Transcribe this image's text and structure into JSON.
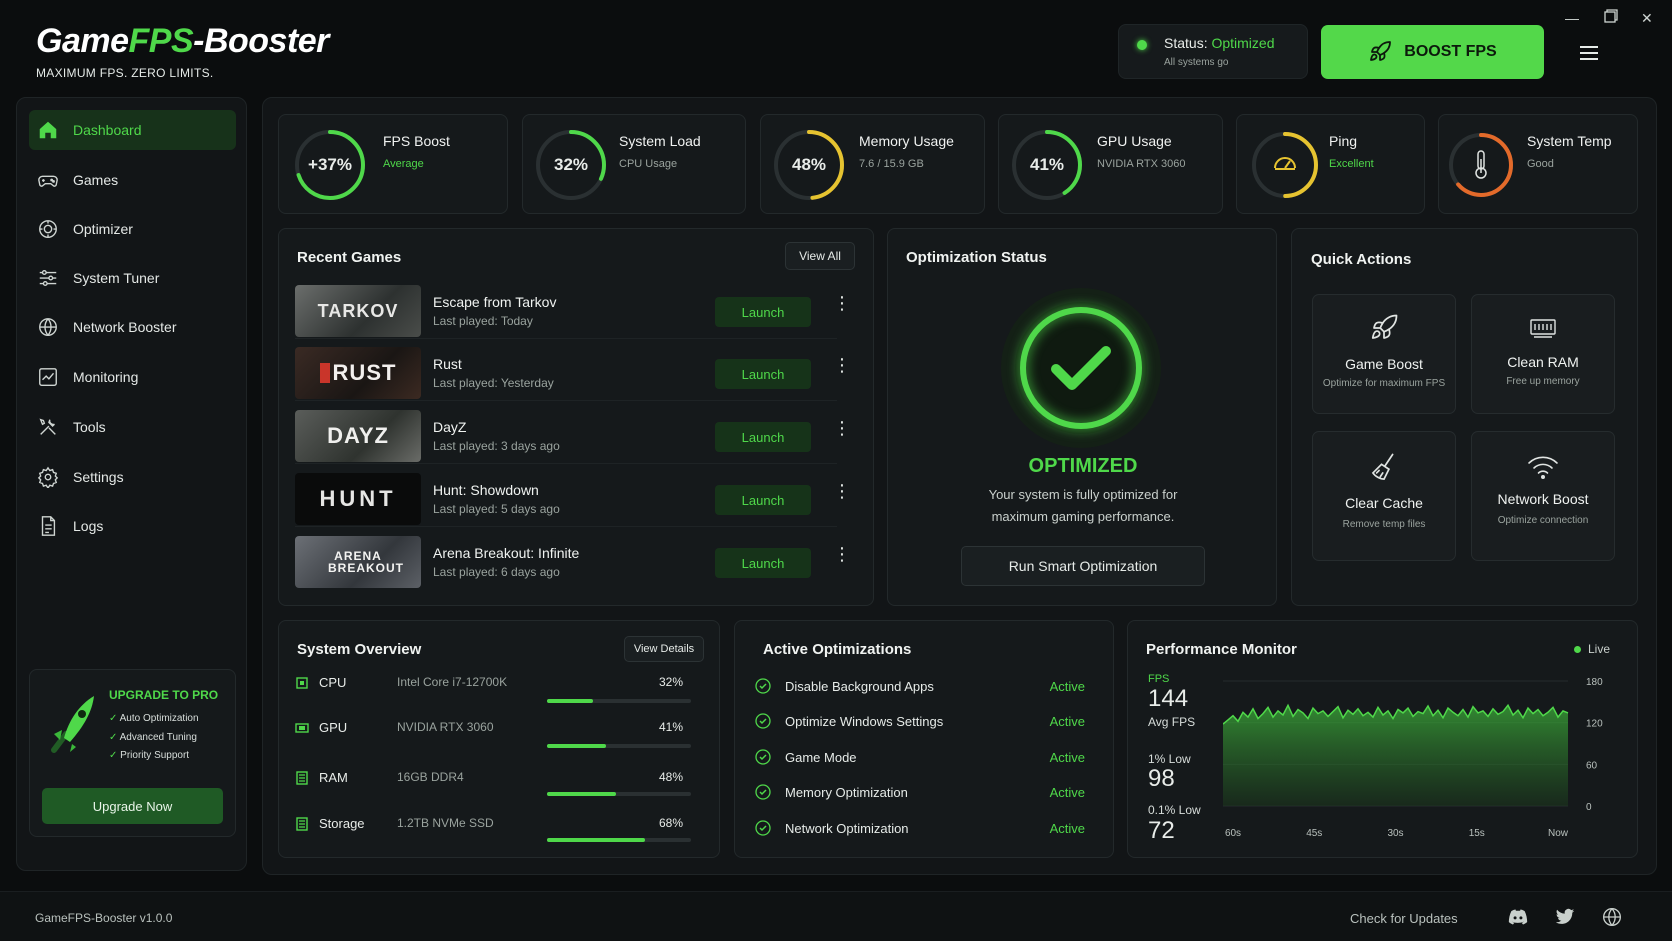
{
  "app": {
    "logo_part1": "Game",
    "logo_part2": "FPS",
    "logo_part3": "-Booster",
    "tagline": "MAXIMUM FPS. ZERO LIMITS.",
    "status_label": "Status: ",
    "status_value": "Optimized",
    "status_sub": "All systems go",
    "boost_label": "BOOST FPS"
  },
  "colors": {
    "accent": "#4fd84a",
    "ring_yellow": "#e6c330",
    "ring_orange": "#e36a2a"
  },
  "sidebar": {
    "items": [
      {
        "label": "Dashboard",
        "icon": "home-icon"
      },
      {
        "label": "Games",
        "icon": "gamepad-icon"
      },
      {
        "label": "Optimizer",
        "icon": "gauge-icon"
      },
      {
        "label": "System Tuner",
        "icon": "sliders-icon"
      },
      {
        "label": "Network Booster",
        "icon": "globe-icon"
      },
      {
        "label": "Monitoring",
        "icon": "chart-icon"
      },
      {
        "label": "Tools",
        "icon": "tools-icon"
      },
      {
        "label": "Settings",
        "icon": "gear-icon"
      },
      {
        "label": "Logs",
        "icon": "document-icon"
      }
    ],
    "upgrade": {
      "title": "UPGRADE TO PRO",
      "features": [
        "Auto Optimization",
        "Advanced Tuning",
        "Priority Support"
      ],
      "button": "Upgrade Now"
    }
  },
  "stats": [
    {
      "value": "+37%",
      "title": "FPS Boost",
      "sub": "Average",
      "progress": 0.7
    },
    {
      "value": "32%",
      "title": "System Load",
      "sub": "CPU Usage",
      "progress": 0.32
    },
    {
      "value": "48%",
      "title": "Memory Usage",
      "sub": "7.6 / 15.9 GB",
      "progress": 0.48
    },
    {
      "value": "41%",
      "title": "GPU Usage",
      "sub": "NVIDIA RTX 3060",
      "progress": 0.41
    },
    {
      "value": "",
      "title": "Ping",
      "sub": "Excellent",
      "progress": 0.5
    },
    {
      "value": "",
      "title": "System Temp",
      "sub": "Good",
      "progress": 0.5
    }
  ],
  "recent_games": {
    "title": "Recent Games",
    "view_all": "View All",
    "launch": "Launch",
    "items": [
      {
        "name": "Escape from Tarkov",
        "last": "Last played: Today",
        "thumb": "TARKOV"
      },
      {
        "name": "Rust",
        "last": "Last played: Yesterday",
        "thumb": "RUST"
      },
      {
        "name": "DayZ",
        "last": "Last played: 3 days ago",
        "thumb": "DAYZ"
      },
      {
        "name": "Hunt: Showdown",
        "last": "Last played: 5 days ago",
        "thumb": "HUNT"
      },
      {
        "name": "Arena Breakout: Infinite",
        "last": "Last played: 6 days ago",
        "thumb": "ARENA BREAKOUT"
      }
    ]
  },
  "optimization": {
    "title": "Optimization Status",
    "state": "OPTIMIZED",
    "desc1": "Your system is fully optimized for",
    "desc2": "maximum gaming performance.",
    "button": "Run Smart Optimization"
  },
  "quick_actions": {
    "title": "Quick Actions",
    "items": [
      {
        "title": "Game Boost",
        "sub": "Optimize for maximum FPS",
        "icon": "rocket-icon"
      },
      {
        "title": "Clean RAM",
        "sub": "Free up memory",
        "icon": "ram-icon"
      },
      {
        "title": "Clear Cache",
        "sub": "Remove temp files",
        "icon": "broom-icon"
      },
      {
        "title": "Network Boost",
        "sub": "Optimize connection",
        "icon": "wifi-icon"
      }
    ]
  },
  "system_overview": {
    "title": "System Overview",
    "view_details": "View Details",
    "rows": [
      {
        "name": "CPU",
        "model": "Intel Core i7-12700K",
        "pct": "32%",
        "value": 0.32
      },
      {
        "name": "GPU",
        "model": "NVIDIA RTX 3060",
        "pct": "41%",
        "value": 0.41
      },
      {
        "name": "RAM",
        "model": "16GB DDR4",
        "pct": "48%",
        "value": 0.48
      },
      {
        "name": "Storage",
        "model": "1.2TB NVMe SSD",
        "pct": "68%",
        "value": 0.68
      }
    ]
  },
  "active_optimizations": {
    "title": "Active Optimizations",
    "items": [
      {
        "label": "Disable Background Apps",
        "status": "Active"
      },
      {
        "label": "Optimize Windows Settings",
        "status": "Active"
      },
      {
        "label": "Game Mode",
        "status": "Active"
      },
      {
        "label": "Memory Optimization",
        "status": "Active"
      },
      {
        "label": "Network Optimization",
        "status": "Active"
      }
    ]
  },
  "performance": {
    "title": "Performance Monitor",
    "live": "Live",
    "fps_label": "FPS",
    "fps_value": "144",
    "fps_sub": "Avg FPS",
    "low1_label": "1% Low",
    "low1_value": "98",
    "low01_label": "0.1% Low",
    "low01_value": "72"
  },
  "chart_data": {
    "type": "area",
    "x_ticks": [
      "60s",
      "45s",
      "30s",
      "15s",
      "Now"
    ],
    "y_ticks": [
      "180",
      "120",
      "60",
      "0"
    ],
    "ylim": [
      0,
      180
    ],
    "values": [
      118,
      124,
      130,
      122,
      135,
      128,
      140,
      126,
      133,
      142,
      128,
      137,
      131,
      145,
      129,
      139,
      134,
      126,
      141,
      133,
      137,
      129,
      136,
      143,
      127,
      138,
      132,
      140,
      130,
      135,
      128,
      142,
      131,
      137,
      126,
      139,
      134,
      141,
      129,
      136,
      133,
      144,
      130,
      138,
      127,
      141,
      135,
      130,
      139,
      128,
      143,
      134,
      137,
      129,
      140,
      132,
      136,
      145,
      131,
      138,
      127,
      141,
      133,
      139,
      130,
      135,
      142,
      128,
      137,
      134
    ]
  },
  "footer": {
    "version": "GameFPS-Booster v1.0.0",
    "check": "Check for Updates"
  }
}
